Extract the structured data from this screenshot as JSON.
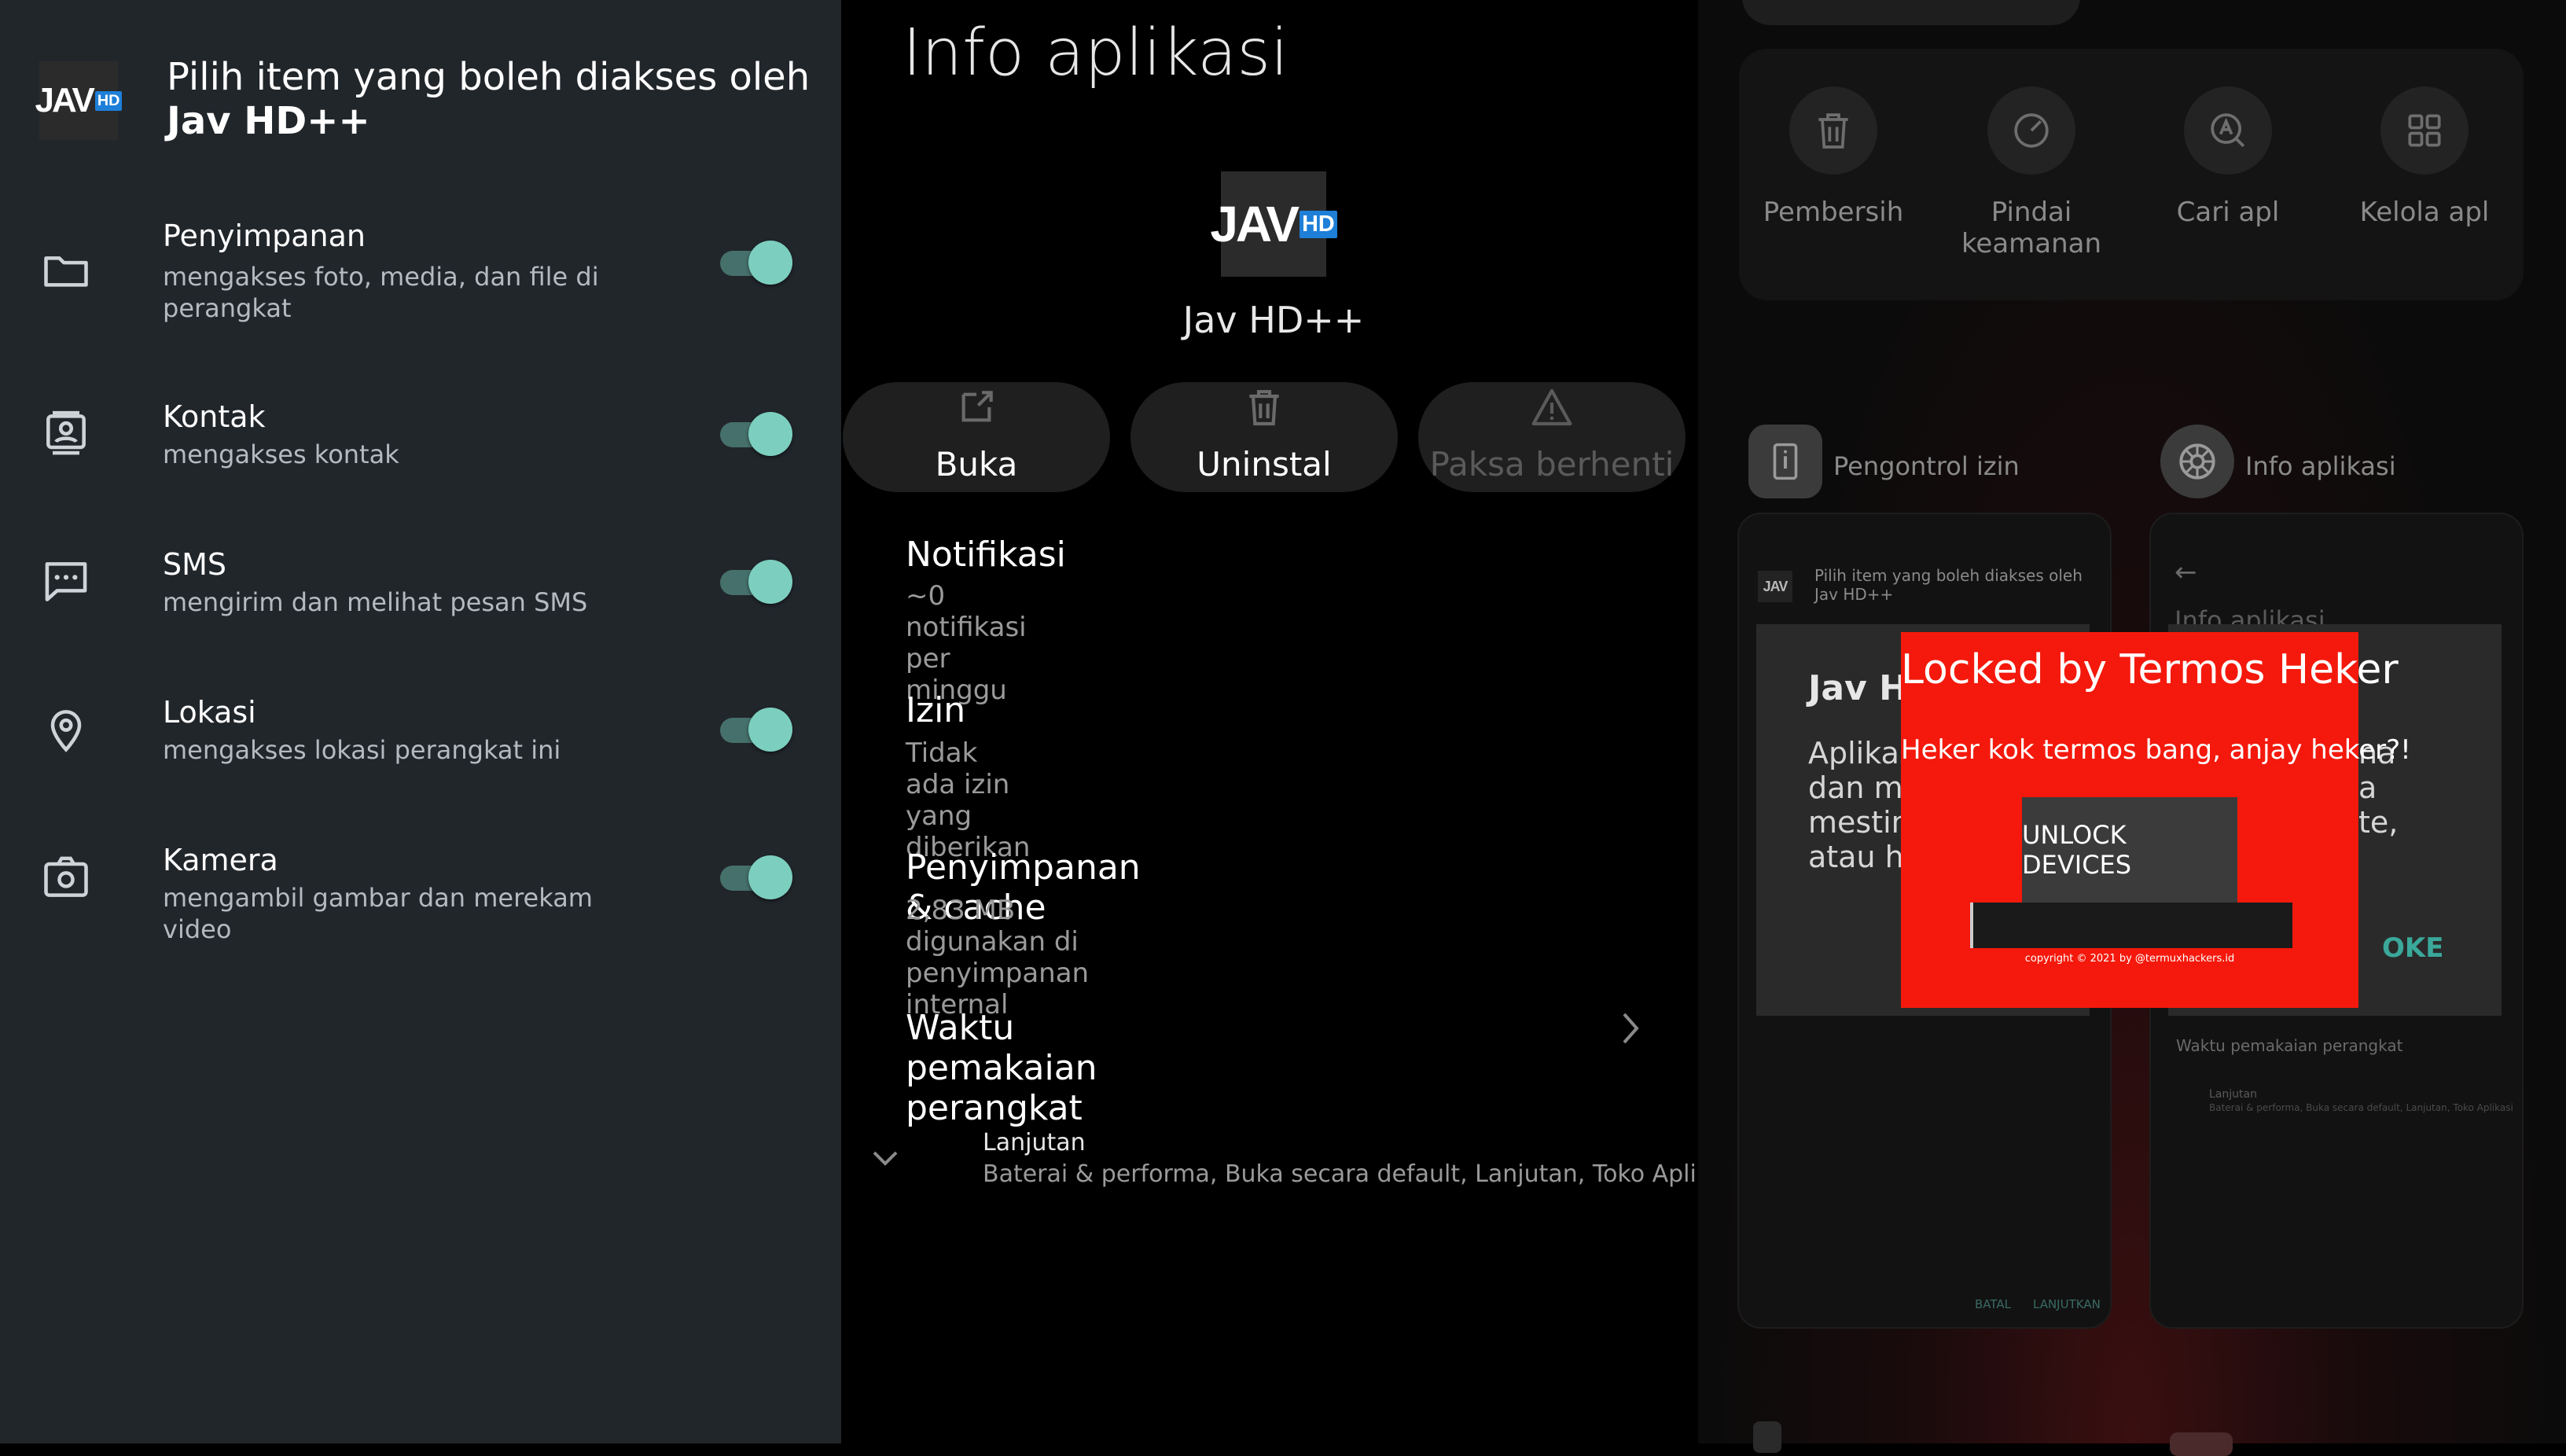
{
  "left_panel": {
    "logo_text": "JAV",
    "logo_badge": "HD",
    "header_line1": "Pilih item yang boleh diakses oleh",
    "header_line2": "Jav HD++",
    "permissions": [
      {
        "icon": "folder-icon",
        "title": "Penyimpanan",
        "subtitle": "mengakses foto, media, dan file di perangkat",
        "enabled": true
      },
      {
        "icon": "contact-card-icon",
        "title": "Kontak",
        "subtitle": "mengakses kontak",
        "enabled": true
      },
      {
        "icon": "message-icon",
        "title": "SMS",
        "subtitle": "mengirim dan melihat pesan SMS",
        "enabled": true
      },
      {
        "icon": "location-pin-icon",
        "title": "Lokasi",
        "subtitle": "mengakses lokasi perangkat ini",
        "enabled": true
      },
      {
        "icon": "camera-icon",
        "title": "Kamera",
        "subtitle": "mengambil gambar dan merekam video",
        "enabled": true
      }
    ]
  },
  "app_info": {
    "title": "Info aplikasi",
    "app_name": "Jav HD++",
    "buttons": {
      "open": "Buka",
      "uninstall": "Uninstal",
      "force_stop": "Paksa berhenti"
    },
    "items": {
      "notifications": {
        "title": "Notifikasi",
        "subtitle": "~0 notifikasi per minggu"
      },
      "permissions": {
        "title": "Izin",
        "subtitle": "Tidak ada izin yang diberikan"
      },
      "storage": {
        "title": "Penyimpanan & cache",
        "subtitle": "2,83 MB digunakan di penyimpanan internal"
      },
      "screen_time": {
        "title": "Waktu pemakaian perangkat"
      },
      "advanced": {
        "title": "Lanjutan",
        "subtitle": "Baterai & performa, Buka secara default, Lanjutan, Toko Aplikasi"
      }
    }
  },
  "recents": {
    "shortcuts": [
      {
        "label": "Pembersih",
        "icon": "trash-icon"
      },
      {
        "label": "Pindai keamanan",
        "icon": "scan-icon"
      },
      {
        "label": "Cari apl",
        "icon": "search-app-icon"
      },
      {
        "label": "Kelola apl",
        "icon": "grid-icon"
      }
    ],
    "card_left": {
      "label": "Pengontrol izin",
      "header_line1": "Pilih item yang boleh diakses oleh",
      "header_line2": "Jav HD++",
      "dialog_title": "Jav H",
      "dialog_text": [
        "Aplikas",
        "dan mu",
        "mestin",
        "atau hu"
      ],
      "footer_cancel": "BATAL",
      "footer_continue": "LANJUTKAN"
    },
    "card_right": {
      "label": "Info aplikasi",
      "bg_title": "Info aplikasi",
      "dialog_text": [
        "na",
        "a",
        "te,"
      ],
      "ok": "OKE",
      "screen_time": "Waktu pemakaian perangkat",
      "advanced": "Lanjutan",
      "advanced_sub": "Baterai & performa, Buka secara default, Lanjutan, Toko Aplikasi"
    }
  },
  "ransom_overlay": {
    "title": "Locked by Termos Heker",
    "message": "Heker kok termos bang, anjay heker?!",
    "unlock_button": "UNLOCK DEVICES",
    "input_value": "",
    "copyright": "copyright © 2021 by @termuxhackers.id"
  },
  "colors": {
    "toggle_on": "#7ccfbf",
    "overlay_red": "#f4190c",
    "ok_teal": "#3aa89a",
    "logo_badge_blue": "#1e7fd8"
  }
}
